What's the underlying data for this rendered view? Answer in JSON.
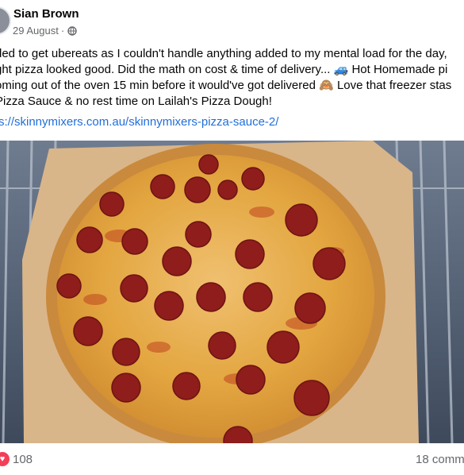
{
  "post": {
    "author": "Sian Brown",
    "date": "29 August",
    "separator": "·",
    "privacy_icon": "globe-icon",
    "text_lines": [
      "ded to get ubereats as I couldn't handle anything added to my mental load for the day,",
      "ght pizza looked good. Did the math on cost & time of delivery... 🚙 Hot Homemade pi",
      "oming out of the oven 15 min before it would've got delivered 🙈 Love that freezer stas",
      "Pizza Sauce & no rest time on Lailah's Pizza Dough!"
    ],
    "link": "s://skinnymixers.com.au/skinnymixers-pizza-sauce-2/"
  },
  "photo": {
    "subject": "pepperoni-pizza-on-oven-rack",
    "colors": {
      "rack_bg": "#5b6a80",
      "paper": "#d8b48a",
      "cheese": "#e0a43c",
      "crust": "#c98a3d",
      "pepperoni": "#8e1d1c"
    }
  },
  "footer": {
    "reactions_icon": "heart-reaction-icon",
    "reaction_count": "108",
    "comments": "18 comm"
  },
  "colors": {
    "link": "#216fdb",
    "secondary_text": "#65676b",
    "heart": "#f33e58"
  }
}
